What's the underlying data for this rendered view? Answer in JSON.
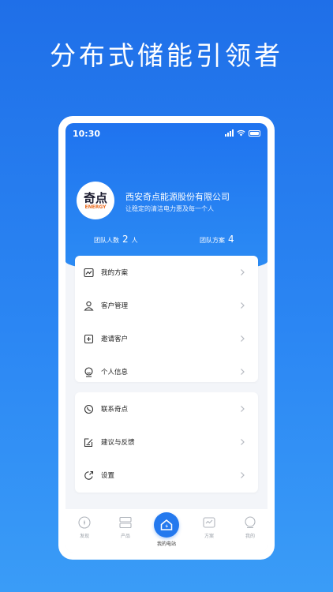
{
  "headline": "分布式储能引领者",
  "status": {
    "time": "10:30"
  },
  "profile": {
    "logo_main": "奇点",
    "logo_sub": "ENERGY",
    "company": "西安奇点能源股份有限公司",
    "slogan": "让稳定的清洁电力惠及每一个人",
    "team_people_label": "团队人数",
    "team_people_value": "2",
    "team_people_unit": "人",
    "team_plans_label": "团队方案",
    "team_plans_value": "4"
  },
  "menu_group1": [
    {
      "label": "我的方案",
      "icon": "chart-icon"
    },
    {
      "label": "客户管理",
      "icon": "customer-icon"
    },
    {
      "label": "邀请客户",
      "icon": "add-icon"
    },
    {
      "label": "个人信息",
      "icon": "person-icon"
    }
  ],
  "menu_group2": [
    {
      "label": "联系奇点",
      "icon": "phone-icon"
    },
    {
      "label": "建议与反馈",
      "icon": "feedback-icon"
    },
    {
      "label": "设置",
      "icon": "settings-icon"
    }
  ],
  "tabbar": {
    "discover": "发现",
    "products": "产品",
    "my_station": "我的电站",
    "plans": "方案",
    "mine": "我的"
  },
  "colors": {
    "brand_blue": "#2479ee",
    "logo_orange": "#e96a1e"
  }
}
